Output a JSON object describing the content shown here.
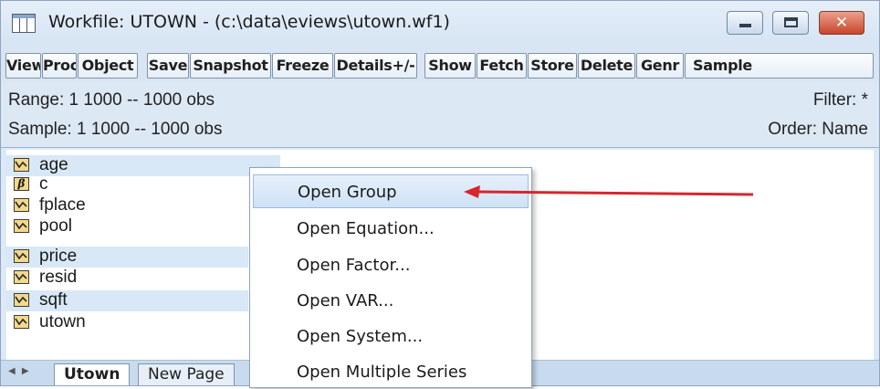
{
  "window": {
    "title": "Workfile: UTOWN - (c:\\data\\eviews\\utown.wf1)"
  },
  "toolbar": {
    "buttons": [
      "View",
      "Proc",
      "Object",
      "Save",
      "Snapshot",
      "Freeze",
      "Details+/-",
      "Show",
      "Fetch",
      "Store",
      "Delete",
      "Genr",
      "Sample"
    ]
  },
  "info": {
    "range": "Range:  1 1000  --  1000 obs",
    "sample": "Sample: 1 1000  --  1000 obs",
    "filter": "Filter: *",
    "order": "Order: Name"
  },
  "objects": [
    {
      "name": "age",
      "icon": "series-icon",
      "selected": true
    },
    {
      "name": "c",
      "icon": "coefficient-beta-icon",
      "selected": false
    },
    {
      "name": "fplace",
      "icon": "series-icon",
      "selected": false
    },
    {
      "name": "pool",
      "icon": "series-icon",
      "selected": false
    },
    {
      "name": "price",
      "icon": "series-icon",
      "selected": true
    },
    {
      "name": "resid",
      "icon": "series-icon",
      "selected": false
    },
    {
      "name": "sqft",
      "icon": "series-icon",
      "selected": true
    },
    {
      "name": "utown",
      "icon": "series-icon",
      "selected": false
    }
  ],
  "tabs": [
    "Utown",
    "New Page"
  ],
  "context_menu": {
    "items": [
      "Open Group",
      "Open Equation...",
      "Open Factor...",
      "Open VAR...",
      "Open System...",
      "Open Multiple Series"
    ],
    "highlighted": "Open Group"
  },
  "colors": {
    "accent_arrow": "#d8262b",
    "selection": "#d8e8f6",
    "icon_fill": "#f3d98a"
  }
}
